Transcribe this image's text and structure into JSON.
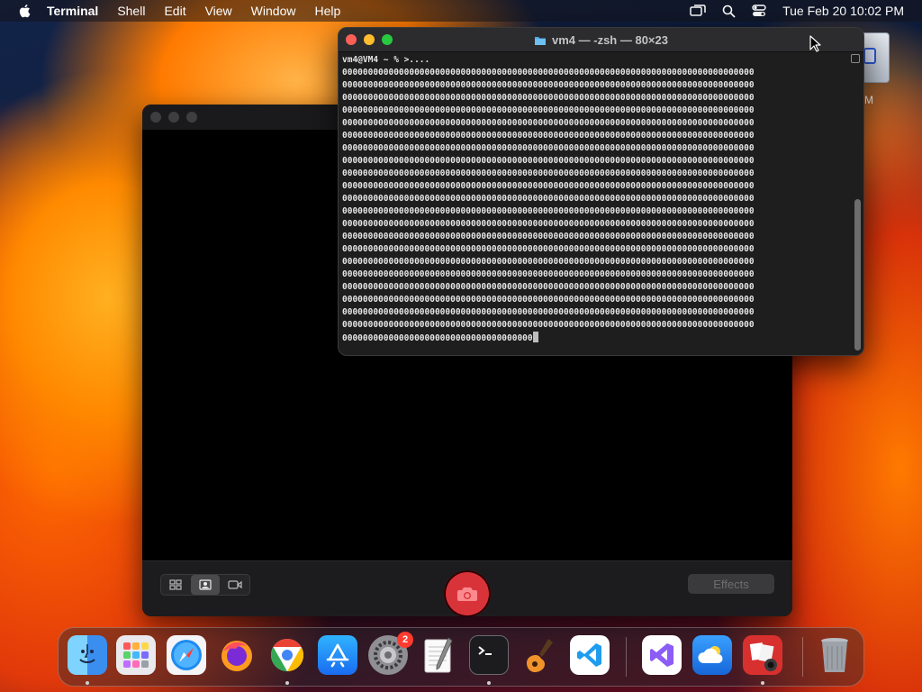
{
  "menubar": {
    "app_name": "Terminal",
    "items": [
      "Shell",
      "Edit",
      "View",
      "Window",
      "Help"
    ],
    "datetime": "Tue Feb 20  10:02 PM",
    "icons": [
      "apple-icon",
      "screen-mirroring-icon",
      "spotlight-search-icon",
      "control-center-icon"
    ]
  },
  "desktop": {
    "item_label": "M"
  },
  "photobooth": {
    "effects_label": "Effects",
    "view_modes": [
      "grid-view-icon",
      "single-photo-icon",
      "video-icon"
    ],
    "selected_mode": "single-photo-icon"
  },
  "terminal": {
    "title": "vm4 — -zsh — 80×23",
    "prompt_line": "vm4@VM4 ~ % >....",
    "output_lines": [
      "00000000000000000000000000000000000000000000000000000000000000000000000000000000",
      "00000000000000000000000000000000000000000000000000000000000000000000000000000000",
      "00000000000000000000000000000000000000000000000000000000000000000000000000000000",
      "00000000000000000000000000000000000000000000000000000000000000000000000000000000",
      "00000000000000000000000000000000000000000000000000000000000000000000000000000000",
      "00000000000000000000000000000000000000000000000000000000000000000000000000000000",
      "00000000000000000000000000000000000000000000000000000000000000000000000000000000",
      "00000000000000000000000000000000000000000000000000000000000000000000000000000000",
      "00000000000000000000000000000000000000000000000000000000000000000000000000000000",
      "00000000000000000000000000000000000000000000000000000000000000000000000000000000",
      "00000000000000000000000000000000000000000000000000000000000000000000000000000000",
      "00000000000000000000000000000000000000000000000000000000000000000000000000000000",
      "00000000000000000000000000000000000000000000000000000000000000000000000000000000",
      "00000000000000000000000000000000000000000000000000000000000000000000000000000000",
      "00000000000000000000000000000000000000000000000000000000000000000000000000000000",
      "00000000000000000000000000000000000000000000000000000000000000000000000000000000",
      "00000000000000000000000000000000000000000000000000000000000000000000000000000000",
      "00000000000000000000000000000000000000000000000000000000000000000000000000000000",
      "00000000000000000000000000000000000000000000000000000000000000000000000000000000",
      "00000000000000000000000000000000000000000000000000000000000000000000000000000000",
      "00000000000000000000000000000000000000000000000000000000000000000000000000000000",
      "0000000000000000000000000000000000000"
    ]
  },
  "dock": {
    "apps": [
      {
        "name": "Finder",
        "icon": "finder-icon",
        "running": true
      },
      {
        "name": "Launchpad",
        "icon": "launchpad-icon",
        "running": false
      },
      {
        "name": "Safari",
        "icon": "safari-icon",
        "running": false
      },
      {
        "name": "Firefox",
        "icon": "firefox-icon",
        "running": false
      },
      {
        "name": "Google Chrome",
        "icon": "chrome-icon",
        "running": true
      },
      {
        "name": "App Store",
        "icon": "app-store-icon",
        "running": false
      },
      {
        "name": "System Settings",
        "icon": "system-settings-icon",
        "running": false,
        "badge": "2"
      },
      {
        "name": "TextEdit",
        "icon": "textedit-icon",
        "running": false
      },
      {
        "name": "Terminal",
        "icon": "terminal-icon",
        "running": true
      },
      {
        "name": "GarageBand",
        "icon": "garageband-icon",
        "running": false
      },
      {
        "name": "Visual Studio Code",
        "icon": "vscode-icon",
        "running": false
      },
      {
        "name": "Visual Studio",
        "icon": "visual-studio-icon",
        "running": false
      },
      {
        "name": "Weather",
        "icon": "weather-icon",
        "running": false
      },
      {
        "name": "Photo Booth",
        "icon": "photo-booth-icon",
        "running": true
      },
      {
        "name": "Trash",
        "icon": "trash-icon",
        "running": false
      }
    ]
  },
  "colors": {
    "close": "#ff5f57",
    "minimize": "#febc2e",
    "maximize": "#28c840",
    "shutter": "#d9333a",
    "badge": "#ff3b30"
  }
}
